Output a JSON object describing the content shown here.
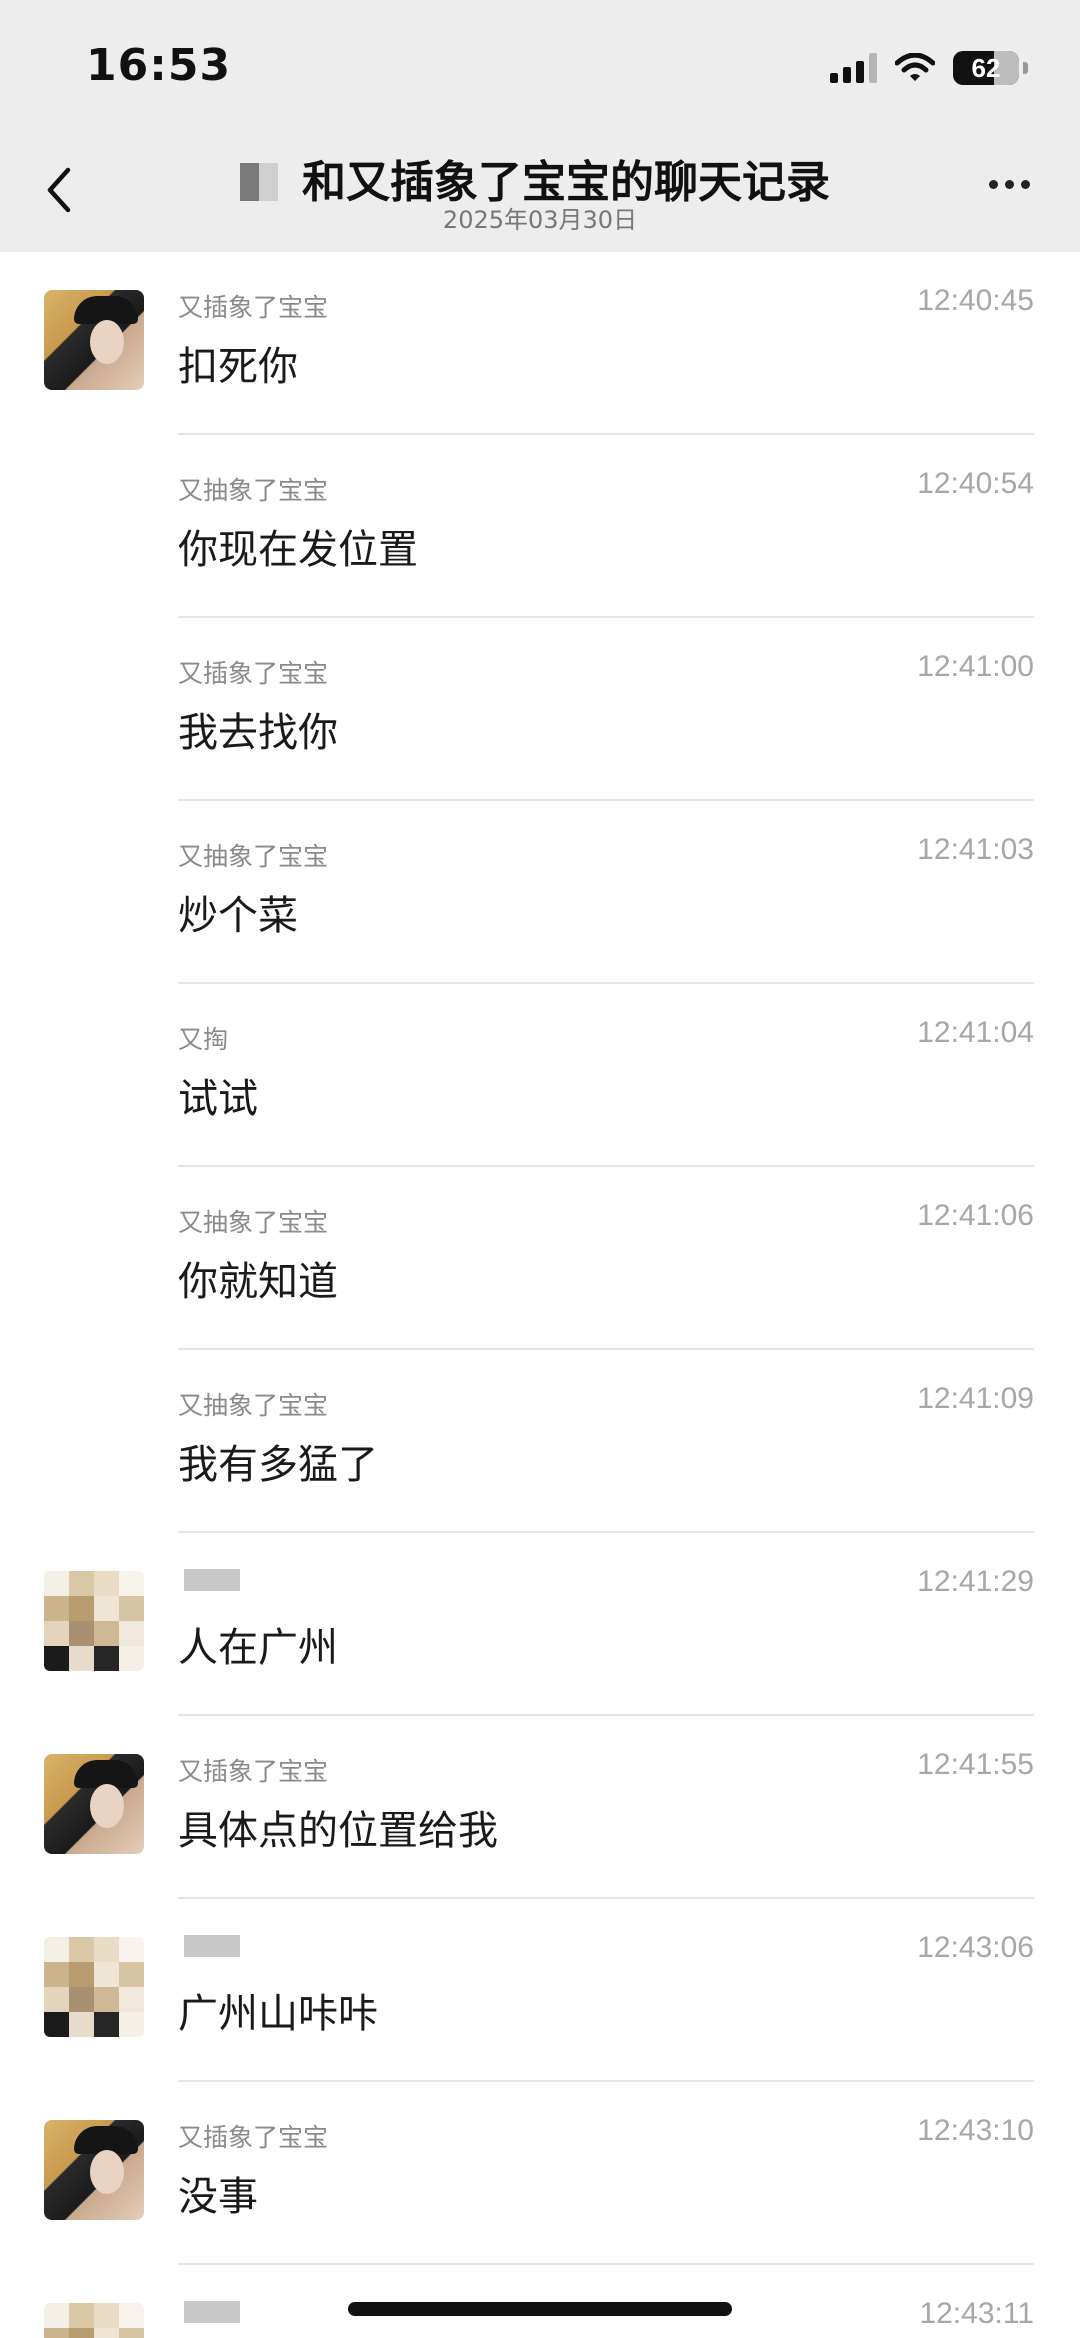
{
  "status_bar": {
    "time": "16:53",
    "battery": "62"
  },
  "header": {
    "title": "和又插象了宝宝的聊天记录",
    "date": "2025年03月30日"
  },
  "messages": [
    {
      "sender": "又插象了宝宝",
      "time": "12:40:45",
      "text": "扣死你",
      "avatar": "photo"
    },
    {
      "sender": "又抽象了宝宝",
      "time": "12:40:54",
      "text": "你现在发位置",
      "avatar": "none"
    },
    {
      "sender": "又插象了宝宝",
      "time": "12:41:00",
      "text": "我去找你",
      "avatar": "none"
    },
    {
      "sender": "又抽象了宝宝",
      "time": "12:41:03",
      "text": "炒个菜",
      "avatar": "none"
    },
    {
      "sender": "又掏",
      "time": "12:41:04",
      "text": "试试",
      "avatar": "none"
    },
    {
      "sender": "又抽象了宝宝",
      "time": "12:41:06",
      "text": "你就知道",
      "avatar": "none"
    },
    {
      "sender": "又抽象了宝宝",
      "time": "12:41:09",
      "text": "我有多猛了",
      "avatar": "none"
    },
    {
      "sender": "",
      "time": "12:41:29",
      "text": "人在广州",
      "avatar": "pixel"
    },
    {
      "sender": "又插象了宝宝",
      "time": "12:41:55",
      "text": "具体点的位置给我",
      "avatar": "photo"
    },
    {
      "sender": "",
      "time": "12:43:06",
      "text": "广州山咔咔",
      "avatar": "pixel"
    },
    {
      "sender": "又插象了宝宝",
      "time": "12:43:10",
      "text": "没事",
      "avatar": "photo"
    },
    {
      "sender": "",
      "time": "12:43:11",
      "text": "",
      "avatar": "pixel"
    }
  ]
}
